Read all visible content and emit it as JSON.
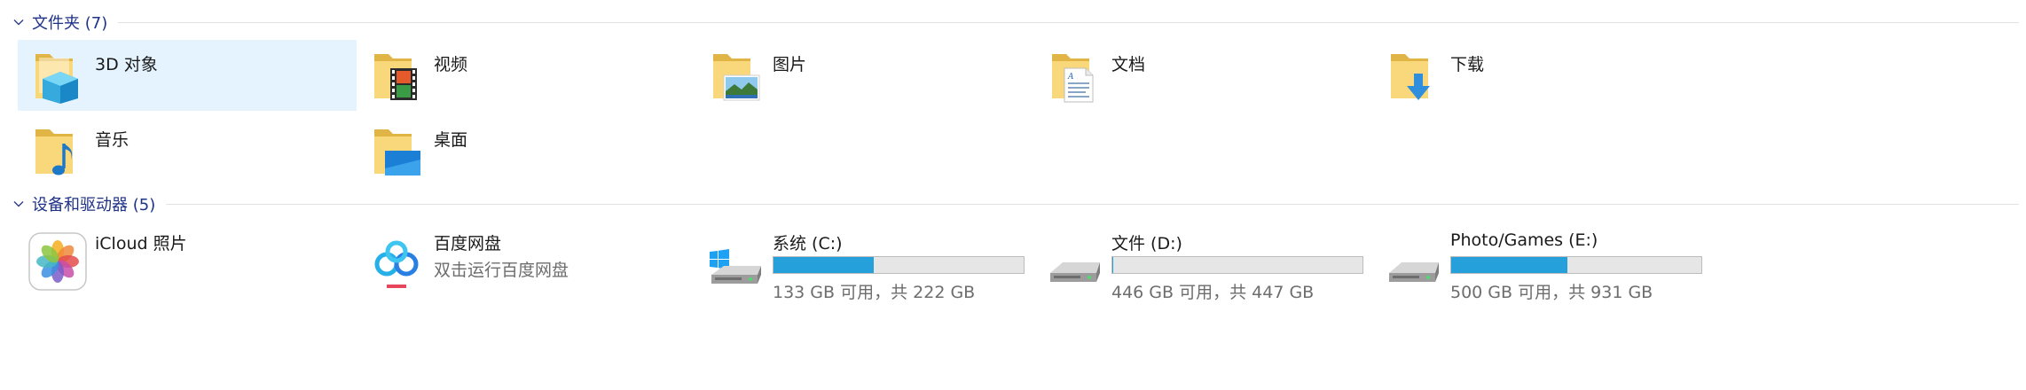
{
  "folders_group": {
    "title": "文件夹 (7)"
  },
  "folders": [
    {
      "label": "3D 对象",
      "icon": "3d-objects-folder-icon",
      "selected": true
    },
    {
      "label": "视频",
      "icon": "videos-folder-icon"
    },
    {
      "label": "图片",
      "icon": "pictures-folder-icon"
    },
    {
      "label": "文档",
      "icon": "documents-folder-icon"
    },
    {
      "label": "下载",
      "icon": "downloads-folder-icon"
    },
    {
      "label": "音乐",
      "icon": "music-folder-icon"
    },
    {
      "label": "桌面",
      "icon": "desktop-folder-icon"
    }
  ],
  "devices_group": {
    "title": "设备和驱动器 (5)"
  },
  "devices": [
    {
      "name": "iCloud 照片",
      "icon": "icloud-photos-icon"
    },
    {
      "name": "百度网盘",
      "subtitle": "双击运行百度网盘",
      "icon": "baidu-netdisk-icon"
    }
  ],
  "drives": [
    {
      "name": "系统 (C:)",
      "free_text": "133 GB 可用，共 222 GB",
      "used_fraction": 0.401,
      "icon": "windows-drive-icon"
    },
    {
      "name": "文件 (D:)",
      "free_text": "446 GB 可用，共 447 GB",
      "used_fraction": 0.002,
      "icon": "hard-drive-icon"
    },
    {
      "name": "Photo/Games (E:)",
      "free_text": "500 GB 可用，共 931 GB",
      "used_fraction": 0.463,
      "icon": "hard-drive-icon"
    }
  ],
  "colors": {
    "accent": "#26a0da",
    "group_title": "#1e3287",
    "selection": "#e5f3ff"
  }
}
